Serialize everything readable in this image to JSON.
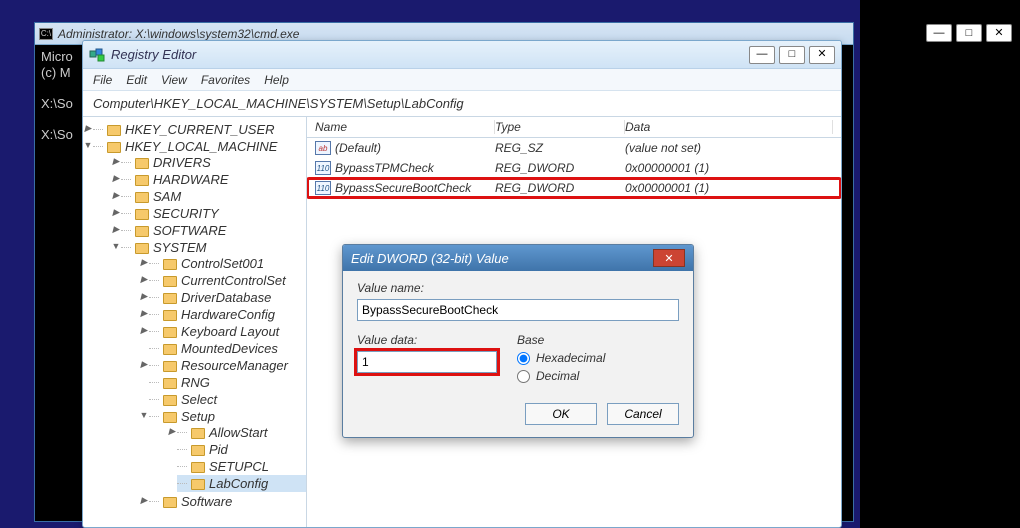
{
  "cmd": {
    "title": "Administrator: X:\\windows\\system32\\cmd.exe",
    "lines": [
      "Micro",
      "(c) M",
      "",
      "X:\\So",
      "",
      "X:\\So"
    ]
  },
  "regedit": {
    "title": "Registry Editor",
    "menus": [
      "File",
      "Edit",
      "View",
      "Favorites",
      "Help"
    ],
    "address": "Computer\\HKEY_LOCAL_MACHINE\\SYSTEM\\Setup\\LabConfig",
    "tree": {
      "hkcu": "HKEY_CURRENT_USER",
      "hklm": "HKEY_LOCAL_MACHINE",
      "drivers": "DRIVERS",
      "hardware": "HARDWARE",
      "sam": "SAM",
      "security": "SECURITY",
      "software": "SOFTWARE",
      "system": "SYSTEM",
      "cs001": "ControlSet001",
      "ccs": "CurrentControlSet",
      "ddb": "DriverDatabase",
      "hwcfg": "HardwareConfig",
      "kbl": "Keyboard Layout",
      "md": "MountedDevices",
      "rm": "ResourceManager",
      "rng": "RNG",
      "select": "Select",
      "setup": "Setup",
      "allowstart": "AllowStart",
      "pid": "Pid",
      "setupcl": "SETUPCL",
      "labconfig": "LabConfig",
      "software2": "Software"
    },
    "columns": {
      "name": "Name",
      "type": "Type",
      "data": "Data"
    },
    "rows": [
      {
        "name": "(Default)",
        "type": "REG_SZ",
        "data": "(value not set)",
        "kind": "sz"
      },
      {
        "name": "BypassTPMCheck",
        "type": "REG_DWORD",
        "data": "0x00000001 (1)",
        "kind": "dw"
      },
      {
        "name": "BypassSecureBootCheck",
        "type": "REG_DWORD",
        "data": "0x00000001 (1)",
        "kind": "dw"
      }
    ]
  },
  "dialog": {
    "title": "Edit DWORD (32-bit) Value",
    "value_name_label": "Value name:",
    "value_name": "BypassSecureBootCheck",
    "value_data_label": "Value data:",
    "value_data": "1",
    "base_label": "Base",
    "hex_label": "Hexadecimal",
    "dec_label": "Decimal",
    "ok": "OK",
    "cancel": "Cancel"
  },
  "win_controls": {
    "min": "—",
    "max": "□",
    "close": "✕"
  }
}
